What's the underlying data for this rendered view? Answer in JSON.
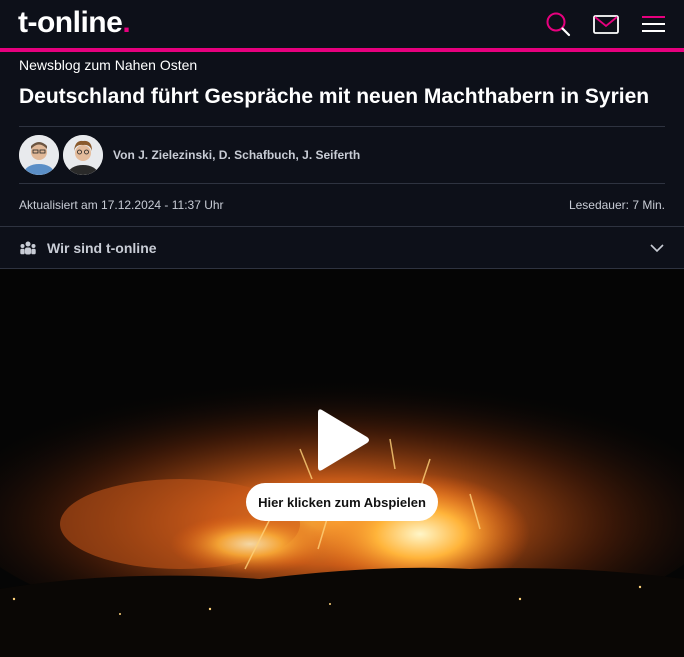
{
  "header": {
    "logo_text": "t-online",
    "logo_dot": ".",
    "accent_color": "#e6007e",
    "icons": [
      "search-icon",
      "mail-icon",
      "menu-icon"
    ]
  },
  "article": {
    "kicker": "Newsblog zum Nahen Osten",
    "title": "Deutschland führt Gespräche mit neuen Machthabern in Syrien",
    "byline": "Von J. Zielezinski, D. Schafbuch, J. Seiferth",
    "updated": "Aktualisiert am 17.12.2024 - 11:37 Uhr",
    "reading_time": "Lesedauer: 7 Min."
  },
  "accordion": {
    "label": "Wir sind t-online",
    "icon": "people-icon"
  },
  "video": {
    "play_label": "Hier klicken zum Abspielen"
  }
}
